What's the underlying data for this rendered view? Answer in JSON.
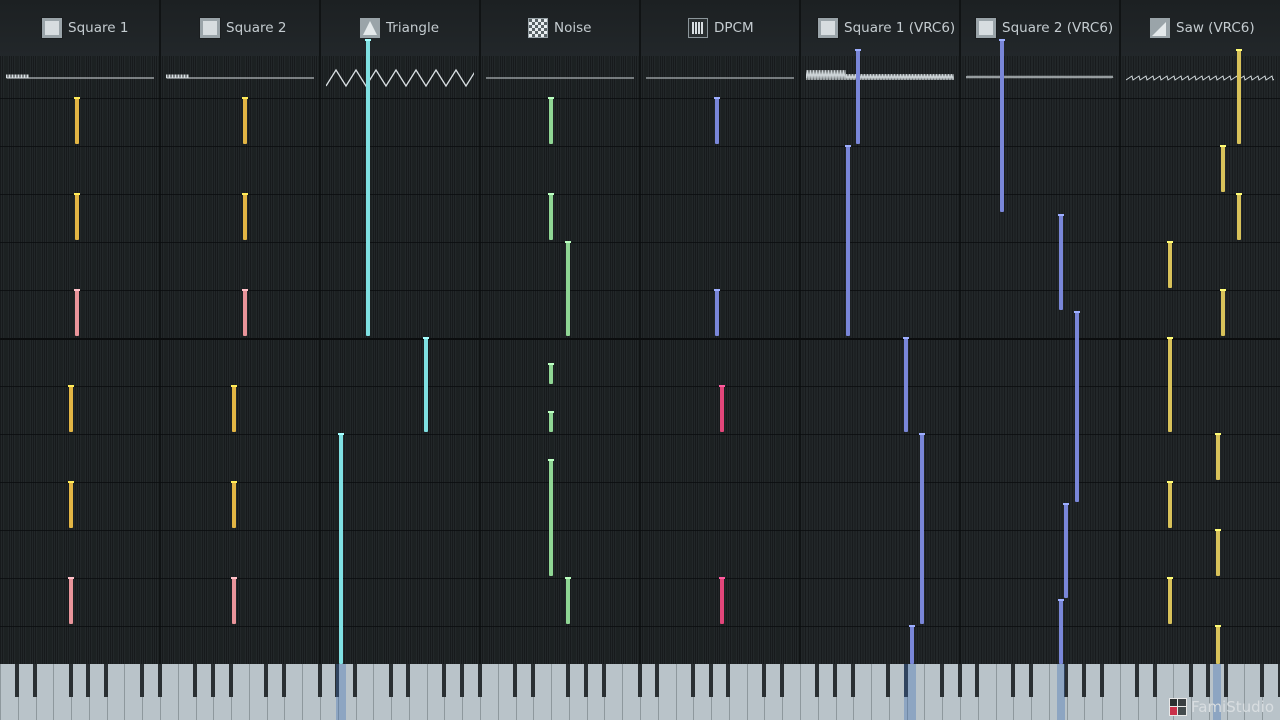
{
  "app": {
    "name": "FamiStudio"
  },
  "channels": [
    {
      "name": "Square 1",
      "icon": "square-wave-icon"
    },
    {
      "name": "Square 2",
      "icon": "square-wave-icon"
    },
    {
      "name": "Triangle",
      "icon": "triangle-wave-icon"
    },
    {
      "name": "Noise",
      "icon": "noise-icon"
    },
    {
      "name": "DPCM",
      "icon": "dpcm-icon"
    },
    {
      "name": "Square 1 (VRC6)",
      "icon": "square-wave-icon"
    },
    {
      "name": "Square 2 (VRC6)",
      "icon": "square-wave-icon"
    },
    {
      "name": "Saw (VRC6)",
      "icon": "saw-wave-icon"
    }
  ],
  "colors": {
    "yellow": "#e2b544",
    "pink": "#e9949a",
    "cyan": "#7fe0e2",
    "green": "#8fd694",
    "blue": "#7986d8",
    "magenta": "#e2467a",
    "gold": "#d8c25a"
  }
}
